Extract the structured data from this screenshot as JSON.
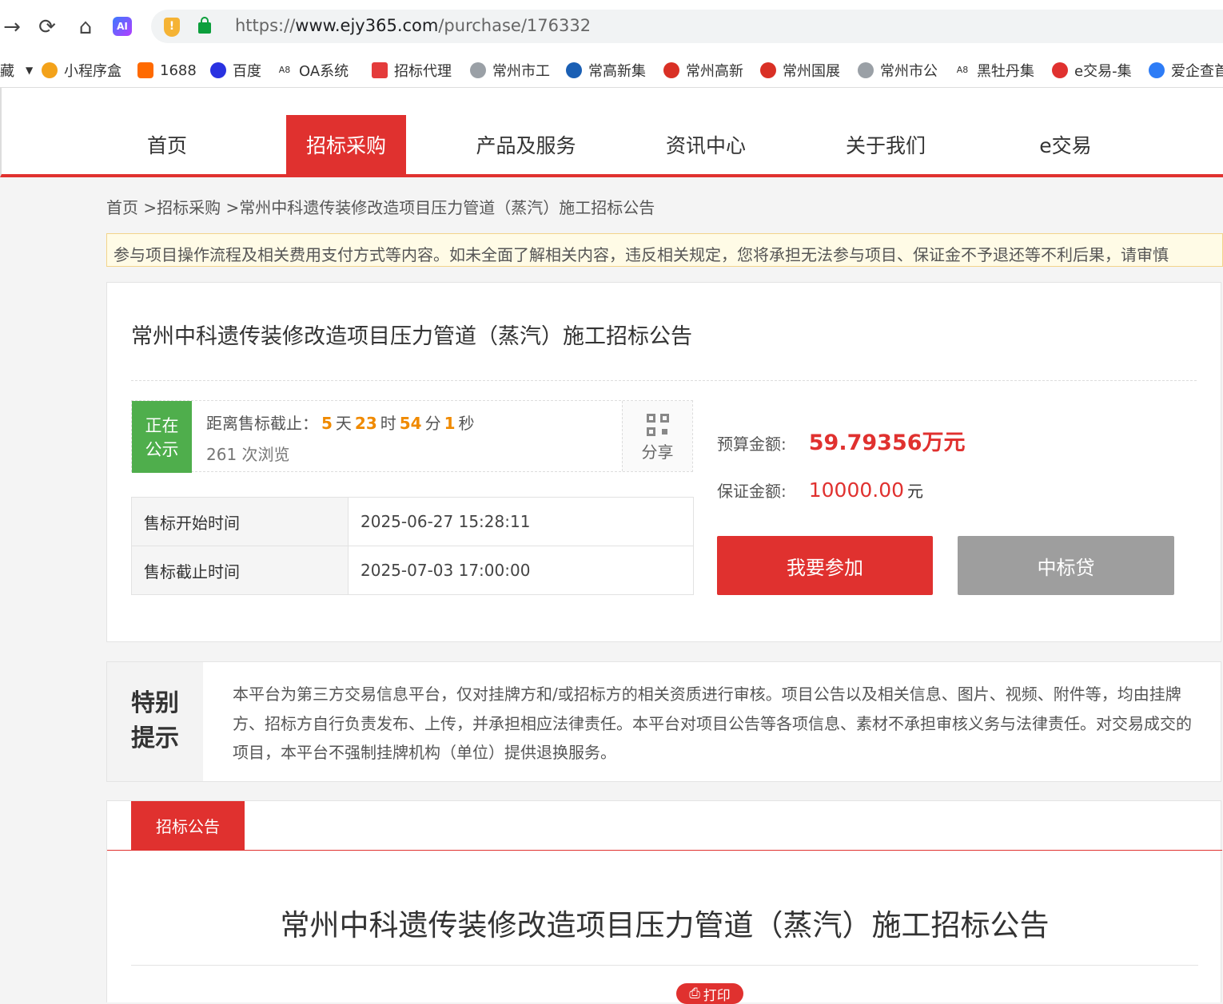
{
  "browser": {
    "url_prefix": "https://",
    "url_host": "www.ejy365.com",
    "url_path": "/purchase/176332",
    "ai_label": "AI",
    "bookmark_clip": "藏",
    "bookmarks": [
      "小程序盒",
      "1688",
      "百度",
      "OA系统",
      "招标代理",
      "常州市工",
      "常高新集",
      "常州高新",
      "常州国展",
      "常州市公",
      "黑牡丹集",
      "e交易-集",
      "爱企查首"
    ]
  },
  "nav": {
    "items": [
      "首页",
      "招标采购",
      "产品及服务",
      "资讯中心",
      "关于我们",
      "e交易"
    ],
    "active_index": 1
  },
  "breadcrumb": "首页 >招标采购 >常州中科遗传装修改造项目压力管道（蒸汽）施工招标公告",
  "notice": "参与项目操作流程及相关费用支付方式等内容。如未全面了解相关内容，违反相关规定，您将承担无法参与项目、保证金不予退还等不利后果，请审慎",
  "project": {
    "title": "常州中科遗传装修改造项目压力管道（蒸汽）施工招标公告",
    "status_line1": "正在",
    "status_line2": "公示",
    "countdown_label": "距离售标截止：",
    "days": "5",
    "days_unit": "天",
    "hours": "23",
    "hours_unit": "时",
    "minutes": "54",
    "minutes_unit": "分",
    "seconds": "1",
    "seconds_unit": "秒",
    "views": "261 次浏览",
    "share_label": "分享",
    "times": [
      {
        "label": "售标开始时间",
        "value": "2025-06-27 15:28:11"
      },
      {
        "label": "售标截止时间",
        "value": "2025-07-03 17:00:00"
      }
    ],
    "budget_label": "预算金额:",
    "budget_value": "59.79356万元",
    "deposit_label": "保证金额:",
    "deposit_value": "10000.00",
    "deposit_unit": "元",
    "join_button": "我要参加",
    "loan_button": "中标贷"
  },
  "tip": {
    "title_line1": "特别",
    "title_line2": "提示",
    "text": "本平台为第三方交易信息平台，仅对挂牌方和/或招标方的相关资质进行审核。项目公告以及相关信息、图片、视频、附件等，均由挂牌方、招标方自行负责发布、上传，并承担相应法律责任。本平台对项目公告等各项信息、素材不承担审核义务与法律责任。对交易成交的项目，本平台不强制挂牌机构（单位）提供退换服务。"
  },
  "announcement": {
    "tab_label": "招标公告",
    "title": "常州中科遗传装修改造项目压力管道（蒸汽）施工招标公告",
    "print_label": "打印"
  },
  "colors": {
    "brand_red": "#e0312f",
    "status_green": "#4fae4c",
    "countdown_orange": "#f08a00",
    "loan_gray": "#9e9e9e"
  }
}
